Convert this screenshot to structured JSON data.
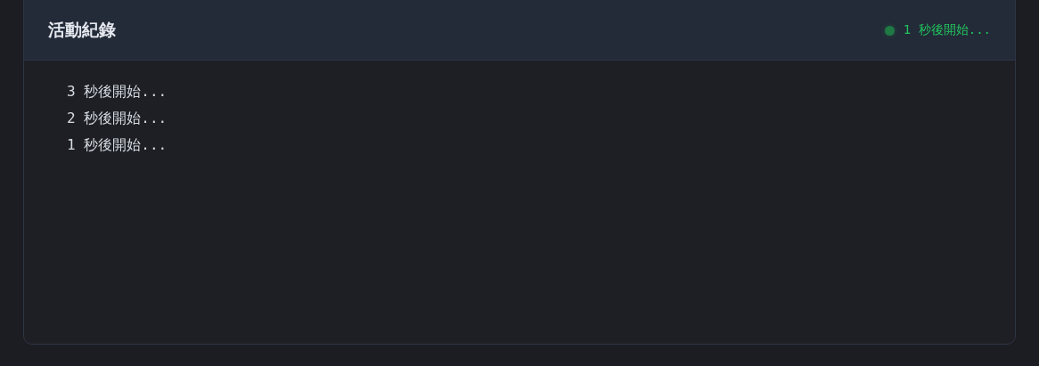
{
  "panel": {
    "title": "活動紀錄",
    "status": {
      "label": "1 秒後開始...",
      "active": true
    }
  },
  "log": {
    "lines": [
      "3 秒後開始...",
      "2 秒後開始...",
      "1 秒後開始..."
    ]
  }
}
